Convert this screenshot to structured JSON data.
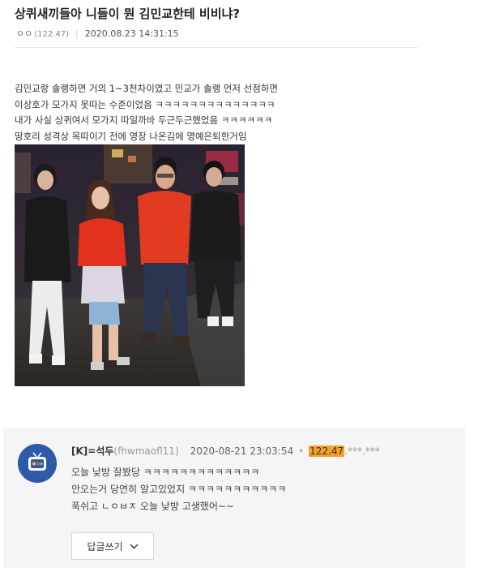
{
  "post": {
    "title": "상퀴새끼들아 니들이 뭔 김민교한테 비비냐?",
    "author": "ㅇㅇ",
    "ip": "(122.47)",
    "datetime": "2020.08.23 14:31:15",
    "body_lines": [
      "김민교랑 솔랭하면 거의 1~3천차이였고 민교가 솔랭 먼저 선점하면",
      "이상호가 모가지 못따는 수준이었음 ㅋㅋㅋㅋㅋㅋㅋㅋㅋㅋㅋㅋㅋㅋ",
      "내가 사실 상퀴여서 모가지 따일까바 두근두근했었음 ㅋㅋㅋㅋㅋㅋ",
      "땅호리 성격상 목따이기 전에 영장 나온김에 명예은퇴한거임"
    ]
  },
  "comment": {
    "nickname": "[K]=석두",
    "user_id": "(fhwmaofl11)",
    "datetime": "2020-08-21 23:03:54",
    "ip_highlight": "122.47",
    "ip_masked": ".***.***",
    "lines": [
      "오늘 낮방 잘봤당 ㅋㅋㅋㅋㅋㅋㅋㅋㅋㅋㅋㅋㅋ",
      "안오는거 당연히 알고있었지 ㅋㅋㅋㅋㅋㅋㅋㅋㅋㅋㅋ",
      "푹쉬고 ㄴㅇㅂㅈ 오늘 낮방 고생했어~~"
    ]
  },
  "reply_button": {
    "label": "답글쓰기",
    "icon": "chevron-down-icon"
  },
  "colors": {
    "ip_highlight_bg": "#f7a02a",
    "comment_bg": "#f5f5f7",
    "avatar_bg": "#2f5aa8"
  }
}
